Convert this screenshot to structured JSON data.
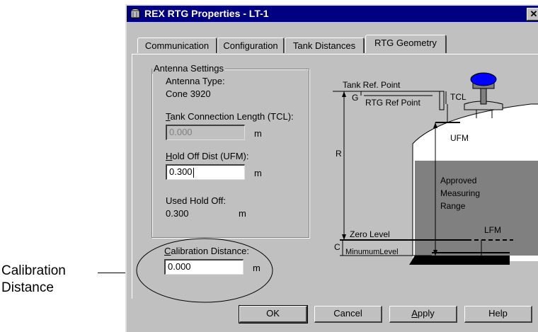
{
  "callout": {
    "line1": "Calibration",
    "line2": "Distance"
  },
  "window": {
    "title": "REX RTG Properties - LT-1",
    "close": "✕"
  },
  "tabs": [
    {
      "label": "Communication"
    },
    {
      "label": "Configuration"
    },
    {
      "label": "Tank Distances"
    },
    {
      "label": "RTG Geometry",
      "active": true
    }
  ],
  "antenna": {
    "group_label": "Antenna Settings",
    "type_label": "Antenna Type:",
    "type_value": "Cone 3920",
    "tcl_label_first": "T",
    "tcl_label_rest": "ank Connection Length (TCL):",
    "tcl_value": "0.000",
    "tcl_unit": "m",
    "ufm_label_first": "H",
    "ufm_label_rest": "old Off Dist (UFM):",
    "ufm_value": "0.300",
    "ufm_unit": "m",
    "used_label": "Used Hold Off:",
    "used_value": "0.300",
    "used_unit": "m"
  },
  "calibration": {
    "label_first": "C",
    "label_rest": "alibration Distance:",
    "value": "0.000",
    "unit": "m"
  },
  "diagram": {
    "tank_ref_point": "Tank Ref. Point",
    "g": "G",
    "rtg_ref_point": "RTG Ref Point",
    "tcl": "TCL",
    "ufm": "UFM",
    "r": "R",
    "range1": "Approved",
    "range2": "Measuring",
    "range3": "Range",
    "lfm": "LFM",
    "zero_level": "Zero Level",
    "c": "C",
    "min_level": "MinumumLevel"
  },
  "buttons": {
    "ok": "OK",
    "cancel": "Cancel",
    "apply_first": "A",
    "apply_rest": "pply",
    "help": "Help"
  }
}
